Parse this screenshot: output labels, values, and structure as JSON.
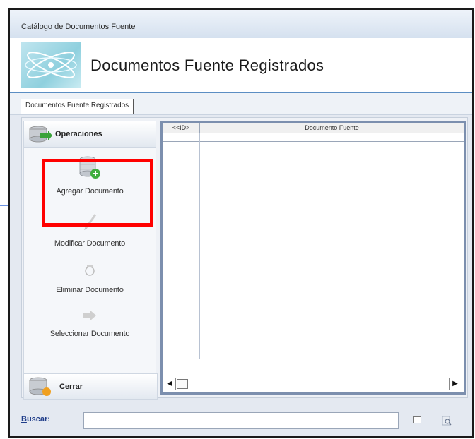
{
  "window": {
    "title": "Catálogo de Documentos Fuente"
  },
  "header": {
    "title": "Documentos Fuente Registrados"
  },
  "tabs": [
    {
      "label": "Documentos Fuente Registrados",
      "active": true
    }
  ],
  "operations": {
    "header_label": "Operaciones",
    "items": [
      {
        "label": "Agregar Documento",
        "icon": "database-add-icon"
      },
      {
        "label": "Modificar Documento",
        "icon": "pencil-icon"
      },
      {
        "label": "Eliminar Documento",
        "icon": "delete-icon"
      },
      {
        "label": "Seleccionar Documento",
        "icon": "arrow-right-icon"
      }
    ]
  },
  "close_panel": {
    "label": "Cerrar"
  },
  "grid": {
    "columns": [
      "<<ID>",
      "Documento Fuente"
    ],
    "rows": []
  },
  "search": {
    "label_underlined": "B",
    "label_rest": "uscar:",
    "value": "",
    "placeholder": ""
  },
  "colors": {
    "highlight": "#ff0000",
    "annotation_arrow": "#3a6fd8",
    "search_label": "#1f3d8a",
    "grid_border": "#7c8fae"
  }
}
